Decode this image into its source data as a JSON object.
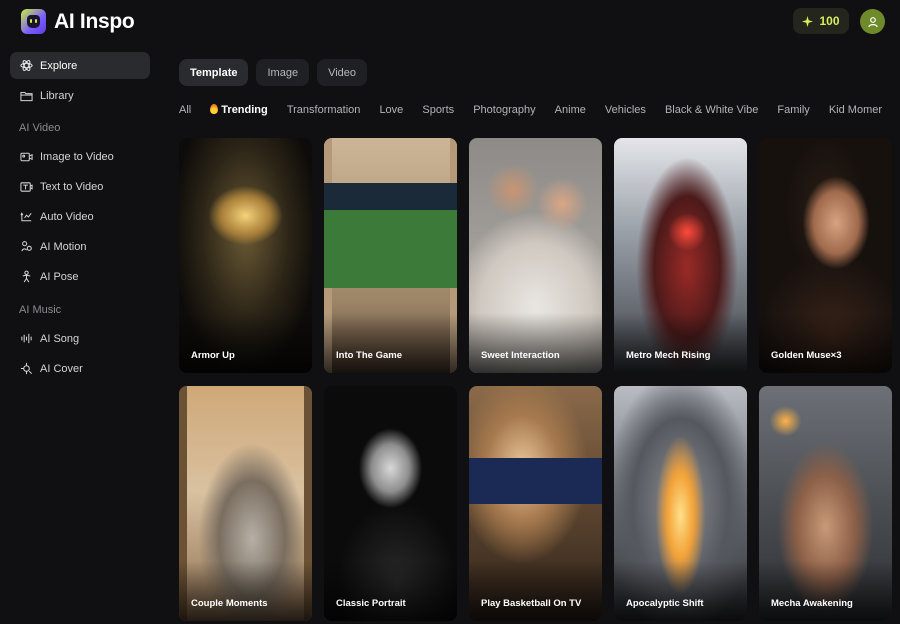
{
  "app": {
    "name": "AI Inspo"
  },
  "header": {
    "credits": "100"
  },
  "sidebar": {
    "top_items": [
      {
        "label": "Explore",
        "icon": "atom-icon"
      },
      {
        "label": "Library",
        "icon": "folder-icon"
      }
    ],
    "sections": [
      {
        "label": "AI Video",
        "items": [
          {
            "label": "Image to Video",
            "icon": "image-video-icon"
          },
          {
            "label": "Text to Video",
            "icon": "text-video-icon"
          },
          {
            "label": "Auto Video",
            "icon": "auto-video-icon"
          },
          {
            "label": "AI Motion",
            "icon": "motion-icon"
          },
          {
            "label": "AI Pose",
            "icon": "pose-icon"
          }
        ]
      },
      {
        "label": "AI Music",
        "items": [
          {
            "label": "AI Song",
            "icon": "song-icon"
          },
          {
            "label": "AI Cover",
            "icon": "cover-icon"
          }
        ]
      }
    ]
  },
  "type_tabs": [
    "Template",
    "Image",
    "Video"
  ],
  "categories": [
    "All",
    "Trending",
    "Transformation",
    "Love",
    "Sports",
    "Photography",
    "Anime",
    "Vehicles",
    "Black & White Vibe",
    "Family",
    "Kid Momer"
  ],
  "cards": [
    {
      "title": "Armor Up"
    },
    {
      "title": "Into The Game"
    },
    {
      "title": "Sweet Interaction"
    },
    {
      "title": "Metro Mech Rising"
    },
    {
      "title": "Golden Muse×3"
    },
    {
      "title": "Couple Moments"
    },
    {
      "title": "Classic Portrait"
    },
    {
      "title": "Play Basketball On TV"
    },
    {
      "title": "Apocalyptic Shift"
    },
    {
      "title": "Mecha Awakening"
    }
  ]
}
